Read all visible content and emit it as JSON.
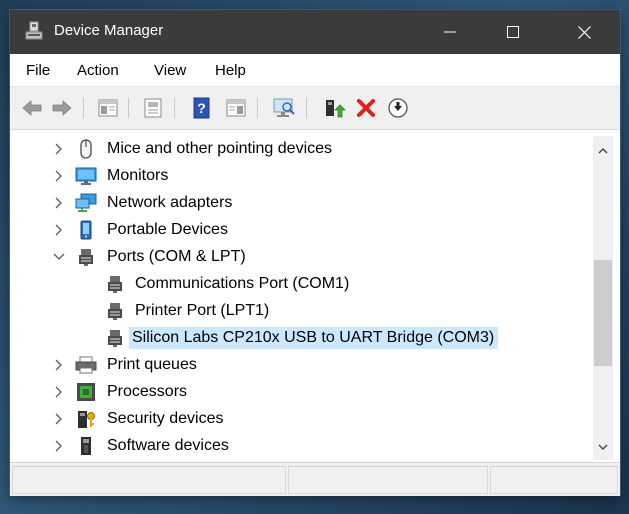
{
  "window": {
    "title": "Device Manager",
    "icon": "device-manager-icon"
  },
  "menubar": {
    "items": [
      {
        "label": "File"
      },
      {
        "label": "Action"
      },
      {
        "label": "View"
      },
      {
        "label": "Help"
      }
    ]
  },
  "toolbar": {
    "buttons": [
      "back-arrow-icon",
      "forward-arrow-icon",
      "properties-icon",
      "show-hide-console-tree-icon",
      "help-icon",
      "action-pane-icon",
      "scan-hardware-changes-icon",
      "update-driver-icon",
      "uninstall-device-icon",
      "download-icon"
    ]
  },
  "tree": {
    "rows": [
      {
        "label": "Mice and other pointing devices",
        "icon": "mouse-icon",
        "expanded": false
      },
      {
        "label": "Monitors",
        "icon": "monitor-icon",
        "expanded": false
      },
      {
        "label": "Network adapters",
        "icon": "network-adapter-icon",
        "expanded": false
      },
      {
        "label": "Portable Devices",
        "icon": "portable-device-icon",
        "expanded": false
      },
      {
        "label": "Ports (COM & LPT)",
        "icon": "port-icon",
        "expanded": true
      },
      {
        "label": "Communications Port (COM1)",
        "icon": "port-icon",
        "child": true
      },
      {
        "label": "Printer Port (LPT1)",
        "icon": "port-icon",
        "child": true
      },
      {
        "label": "Silicon Labs CP210x USB to UART Bridge (COM3)",
        "icon": "port-icon",
        "child": true,
        "selected": true
      },
      {
        "label": "Print queues",
        "icon": "printer-icon",
        "expanded": false
      },
      {
        "label": "Processors",
        "icon": "processor-icon",
        "expanded": false
      },
      {
        "label": "Security devices",
        "icon": "security-device-icon",
        "expanded": false
      },
      {
        "label": "Software devices",
        "icon": "software-device-icon",
        "expanded": false
      }
    ]
  },
  "colors": {
    "titlebar": "#3b3b3b",
    "selection": "#cce8ff",
    "toolbar": "#f0f0f0"
  }
}
